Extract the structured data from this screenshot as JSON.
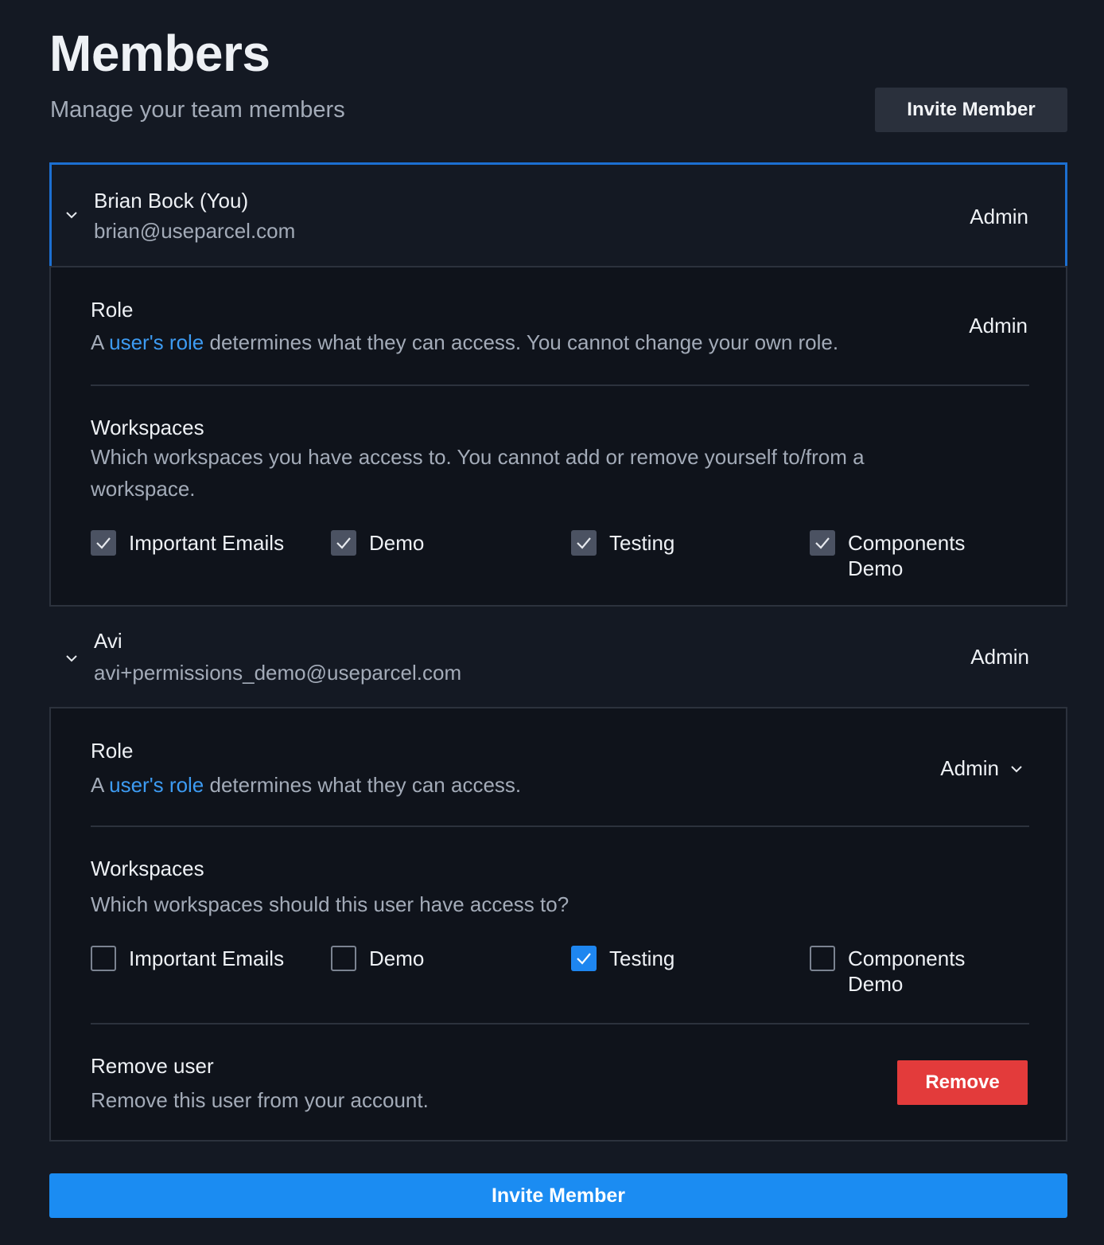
{
  "header": {
    "title": "Members",
    "subtitle": "Manage your team members",
    "invite_button": "Invite Member"
  },
  "members": [
    {
      "name": "Brian Bock (You)",
      "email": "brian@useparcel.com",
      "role": "Admin",
      "expanded": true,
      "selected": true,
      "details": {
        "role_title": "Role",
        "role_desc_prefix": "A ",
        "role_desc_link": "user's role",
        "role_desc_suffix": " determines what they can access. You cannot change your own role.",
        "role_value": "Admin",
        "workspaces_title": "Workspaces",
        "workspaces_desc": "Which workspaces you have access to. You cannot add or remove yourself to/from a workspace.",
        "workspaces": [
          {
            "label": "Important Emails",
            "state": "disabled-checked"
          },
          {
            "label": "Demo",
            "state": "disabled-checked"
          },
          {
            "label": "Testing",
            "state": "disabled-checked"
          },
          {
            "label": "Components Demo",
            "state": "disabled-checked"
          }
        ]
      }
    },
    {
      "name": "Avi",
      "email": "avi+permissions_demo@useparcel.com",
      "role": "Admin",
      "expanded": true,
      "details": {
        "role_title": "Role",
        "role_desc_prefix": "A ",
        "role_desc_link": "user's role",
        "role_desc_suffix": " determines what they can access.",
        "role_value": "Admin",
        "workspaces_title": "Workspaces",
        "workspaces_desc": "Which workspaces should this user have access to?",
        "workspaces": [
          {
            "label": "Important Emails",
            "state": "unchecked"
          },
          {
            "label": "Demo",
            "state": "unchecked"
          },
          {
            "label": "Testing",
            "state": "checked"
          },
          {
            "label": "Components Demo",
            "state": "unchecked"
          }
        ],
        "remove_title": "Remove user",
        "remove_desc": "Remove this user from your account.",
        "remove_button": "Remove"
      }
    }
  ],
  "footer": {
    "invite_button": "Invite Member"
  },
  "icons": {
    "chevron": "chevron-down-icon",
    "check": "check-icon"
  },
  "colors": {
    "background": "#141923",
    "panel": "#0f131b",
    "accent": "#1b8cf2",
    "link": "#3d9bf2",
    "danger": "#e33b3b",
    "selected_border": "#1c6fd1"
  }
}
